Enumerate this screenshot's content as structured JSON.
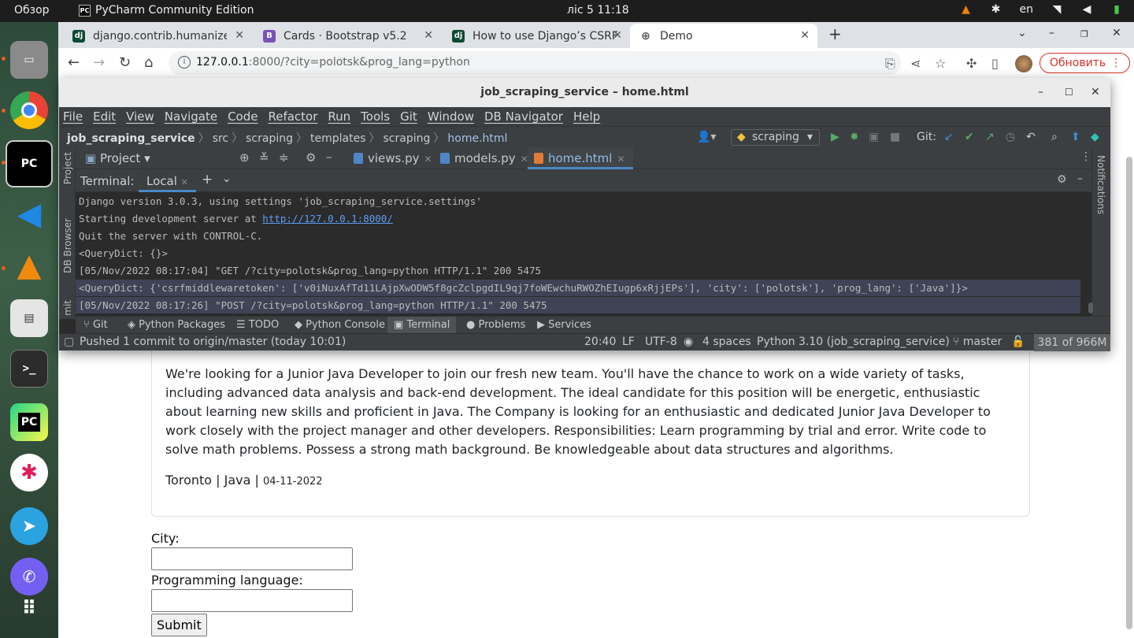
{
  "topbar": {
    "overview": "Обзор",
    "app_name": "PyCharm Community Edition",
    "clock": "ліс 5  11:18",
    "lang": "en"
  },
  "dock": {
    "items": [
      "files-icon",
      "chrome-icon",
      "pycharm-icon",
      "vscode-icon",
      "vlc-icon",
      "document-viewer-icon",
      "terminal-icon",
      "pycharm-edu-icon",
      "slack-icon",
      "telegram-icon",
      "viber-icon",
      "app-grid-icon"
    ]
  },
  "browser": {
    "tabs": [
      {
        "title": "django.contrib.humanize",
        "favicon": "dj"
      },
      {
        "title": "Cards · Bootstrap v5.2",
        "favicon": "B"
      },
      {
        "title": "How to use Django’s CSRF",
        "favicon": "dj"
      },
      {
        "title": "Demo",
        "favicon": "globe"
      }
    ],
    "new_tab": "+",
    "url_host": "127.0.0.1",
    "url_rest": ":8000/?city=polotsk&prog_lang=python",
    "update_label": "Обновить"
  },
  "page": {
    "job_description": "We're looking for a Junior Java Developer to join our fresh new team. You'll have the chance to work on a wide variety of tasks, including advanced data analysis and back-end development. The ideal candidate for this position will be energetic, enthusiastic about learning new skills and proficient in Java. The Company is looking for an enthusiastic and dedicated Junior Java Developer to work closely with the project manager and other developers. Responsibilities: Learn programming by trial and error. Write code to solve math problems. Possess a strong math background. Be knowledgeable about data structures and algorithms.",
    "job_meta": "Toronto | Java | ",
    "job_date": "04-11-2022",
    "city_label": "City:",
    "lang_label": "Programming language:",
    "city_value": "",
    "lang_value": "",
    "submit_label": "Submit"
  },
  "pycharm": {
    "title": "job_scraping_service – home.html",
    "menu": [
      "File",
      "Edit",
      "View",
      "Navigate",
      "Code",
      "Refactor",
      "Run",
      "Tools",
      "Git",
      "Window",
      "DB Navigator",
      "Help"
    ],
    "breadcrumbs": {
      "project": "job_scraping_service",
      "parts": [
        "src",
        "scraping",
        "templates",
        "scraping"
      ],
      "file": "home.html"
    },
    "run_config": "scraping",
    "git_label": "Git:",
    "project_tab": "Project",
    "editor_tabs": [
      {
        "name": "views.py",
        "color": "#4f86c6"
      },
      {
        "name": "models.py",
        "color": "#4f86c6"
      },
      {
        "name": "home.html",
        "color": "#e07b3a"
      }
    ],
    "side_labels": {
      "project": "Project",
      "db": "DB Browser",
      "commit": "mit",
      "notifications": "Notifications"
    },
    "terminal_label": "Terminal:",
    "terminal_tab": "Local",
    "terminal_lines": [
      "Django version 3.0.3, using settings 'job_scraping_service.settings'",
      "Starting development server at ",
      "Quit the server with CONTROL-C.",
      "<QueryDict: {}>",
      "[05/Nov/2022 08:17:04] \"GET /?city=polotsk&prog_lang=python HTTP/1.1\" 200 5475",
      "<QueryDict: {'csrfmiddlewaretoken': ['v0iNuxAfTd11LAjpXwODW5f8gcZclpgdIL9qj7foWEwchuRWOZhEIugp6xRjjEPs'], 'city': ['polotsk'], 'prog_lang': ['Java']}>",
      "[05/Nov/2022 08:17:26] \"POST /?city=polotsk&prog_lang=python HTTP/1.1\" 200 5475"
    ],
    "server_link": "http://127.0.0.1:8000/",
    "tool_windows": [
      "Git",
      "Python Packages",
      "TODO",
      "Python Console",
      "Terminal",
      "Problems",
      "Services"
    ],
    "status": {
      "message": "Pushed 1 commit to origin/master (today 10:01)",
      "position": "20:40",
      "line_sep": "LF",
      "encoding": "UTF-8",
      "indent": "4 spaces",
      "interpreter": "Python 3.10 (job_scraping_service)",
      "branch": "master",
      "memory": "381 of 966M"
    }
  }
}
